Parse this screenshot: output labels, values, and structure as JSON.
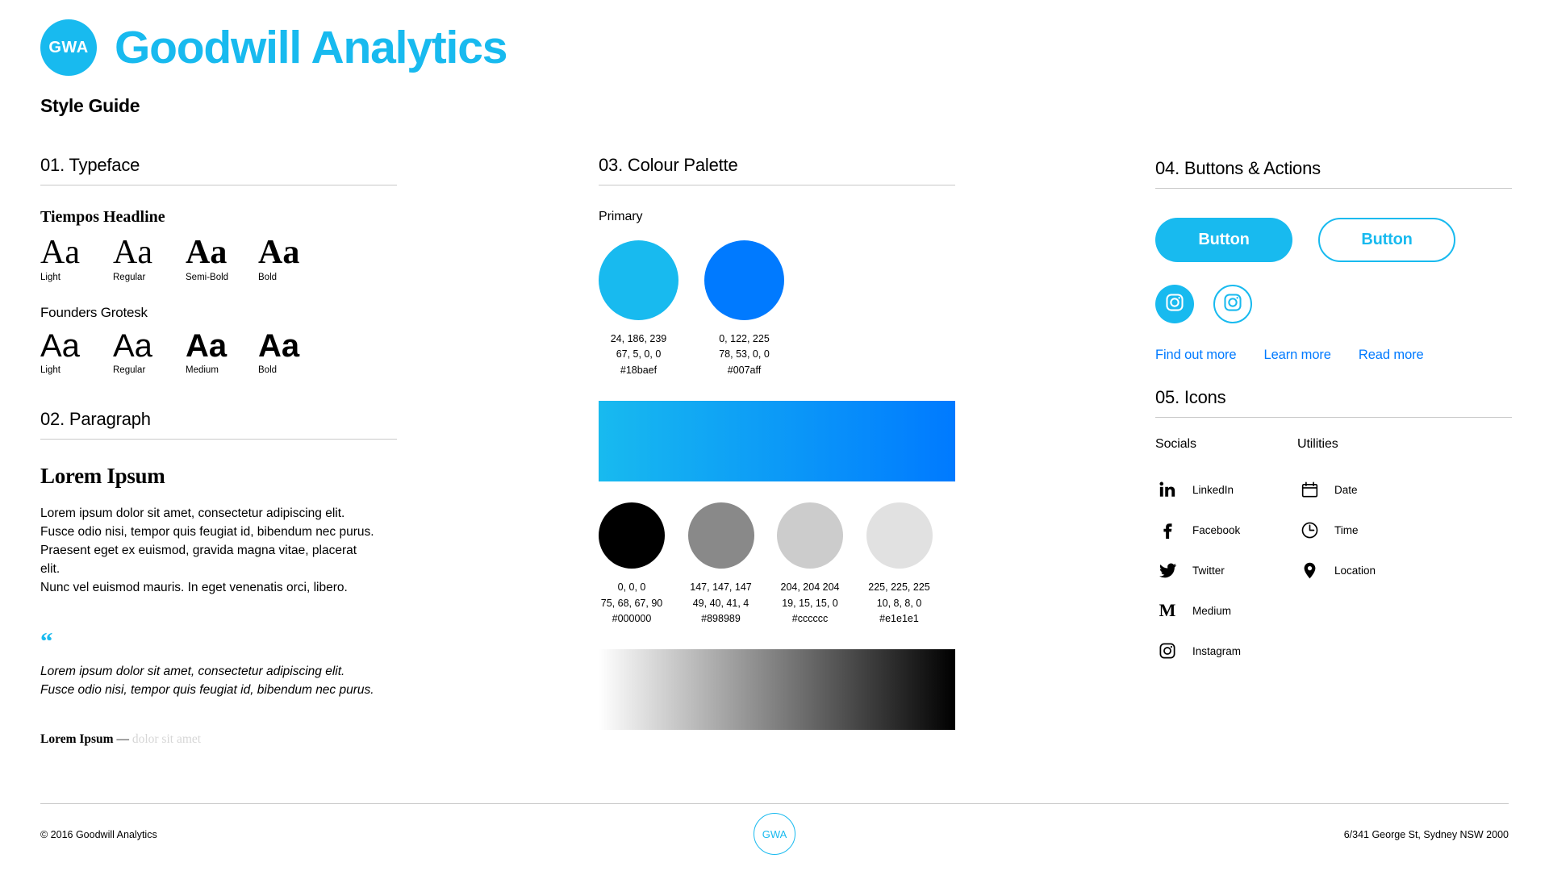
{
  "header": {
    "logo_text": "GWA",
    "brand_title": "Goodwill Analytics",
    "subtitle": "Style Guide"
  },
  "sections": {
    "typeface": {
      "heading": "01. Typeface"
    },
    "paragraph": {
      "heading": "02. Paragraph"
    },
    "palette": {
      "heading": "03. Colour Palette"
    },
    "buttons": {
      "heading": "04. Buttons & Actions"
    },
    "icons": {
      "heading": "05. Icons"
    }
  },
  "typefaces": [
    {
      "name": "Tiempos Headline",
      "style": "serif",
      "specimens": [
        {
          "sample": "Aa",
          "label": "Light"
        },
        {
          "sample": "Aa",
          "label": "Regular"
        },
        {
          "sample": "Aa",
          "label": "Semi-Bold"
        },
        {
          "sample": "Aa",
          "label": "Bold"
        }
      ]
    },
    {
      "name": "Founders Grotesk",
      "style": "sans",
      "specimens": [
        {
          "sample": "Aa",
          "label": "Light"
        },
        {
          "sample": "Aa",
          "label": "Regular"
        },
        {
          "sample": "Aa",
          "label": "Medium"
        },
        {
          "sample": "Aa",
          "label": "Bold"
        }
      ]
    }
  ],
  "paragraph": {
    "title": "Lorem Ipsum",
    "body_lines": [
      "Lorem ipsum dolor sit amet, consectetur adipiscing elit.",
      "Fusce odio nisi, tempor quis feugiat id, bibendum nec purus.",
      "Praesent eget ex euismod, gravida magna vitae, placerat elit.",
      "Nunc vel euismod mauris. In eget venenatis orci, libero."
    ],
    "quote_mark": "“",
    "quote_lines": [
      "Lorem ipsum dolor sit amet, consectetur adipiscing elit.",
      "Fusce odio nisi, tempor quis feugiat id, bibendum nec purus."
    ],
    "attribution_bold": "Lorem Ipsum",
    "attribution_dash": " — ",
    "attribution_muted": "dolor sit amet"
  },
  "palette": {
    "primary_label": "Primary",
    "primary": [
      {
        "hex": "#18baef",
        "rgb": "24, 186, 239",
        "cmyk": "67, 5, 0, 0",
        "hex_label": "#18baef"
      },
      {
        "hex": "#007aff",
        "rgb": "0, 122, 225",
        "cmyk": "78, 53, 0, 0",
        "hex_label": "#007aff"
      }
    ],
    "greys": [
      {
        "hex": "#000000",
        "rgb": "0, 0, 0",
        "cmyk": "75, 68, 67, 90",
        "hex_label": "#000000"
      },
      {
        "hex": "#898989",
        "rgb": "147, 147, 147",
        "cmyk": "49, 40, 41, 4",
        "hex_label": "#898989"
      },
      {
        "hex": "#cccccc",
        "rgb": "204, 204 204",
        "cmyk": "19, 15, 15, 0",
        "hex_label": "#cccccc"
      },
      {
        "hex": "#e1e1e1",
        "rgb": "225, 225, 225",
        "cmyk": "10, 8, 8, 0",
        "hex_label": "#e1e1e1"
      }
    ]
  },
  "buttons": {
    "filled_label": "Button",
    "outline_label": "Button",
    "social_buttons": [
      {
        "icon": "instagram-icon",
        "style": "filled"
      },
      {
        "icon": "instagram-icon",
        "style": "outline"
      }
    ],
    "links": [
      {
        "label": "Find out more"
      },
      {
        "label": "Learn more"
      },
      {
        "label": "Read more"
      }
    ]
  },
  "icons": {
    "socials_heading": "Socials",
    "utilities_heading": "Utilities",
    "socials": [
      {
        "icon": "linkedin-icon",
        "label": "LinkedIn"
      },
      {
        "icon": "facebook-icon",
        "label": "Facebook"
      },
      {
        "icon": "twitter-icon",
        "label": "Twitter"
      },
      {
        "icon": "medium-icon",
        "label": "Medium"
      },
      {
        "icon": "instagram-icon",
        "label": "Instagram"
      }
    ],
    "utilities": [
      {
        "icon": "calendar-icon",
        "label": "Date"
      },
      {
        "icon": "clock-icon",
        "label": "Time"
      },
      {
        "icon": "location-pin-icon",
        "label": "Location"
      }
    ]
  },
  "footer": {
    "copyright": "© 2016 Goodwill Analytics",
    "logo_text": "GWA",
    "address": "6/341 George St, Sydney NSW 2000"
  },
  "colors": {
    "brand_cyan": "#18baef",
    "link_blue": "#007aff",
    "rule": "#c9c9c9"
  }
}
